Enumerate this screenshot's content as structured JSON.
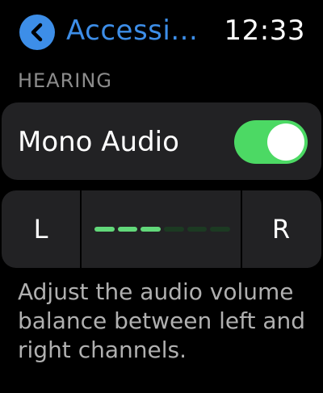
{
  "status": {
    "back_icon": "chevron-left-icon",
    "title": "Accessi...",
    "time": "12:33"
  },
  "hearing": {
    "section_label": "HEARING",
    "mono_audio": {
      "label": "Mono Audio",
      "enabled": true
    },
    "balance": {
      "left_label": "L",
      "right_label": "R",
      "segments_total": 6,
      "segments_filled": 3
    },
    "description": "Adjust the audio volume balance between left and right channels."
  },
  "colors": {
    "accent": "#3d8ee8",
    "toggle_on": "#4cd964",
    "segment_active": "#62d87a",
    "segment_inactive": "#1c3a22",
    "row_background": "#222224",
    "secondary_text": "#8c8c8c"
  }
}
